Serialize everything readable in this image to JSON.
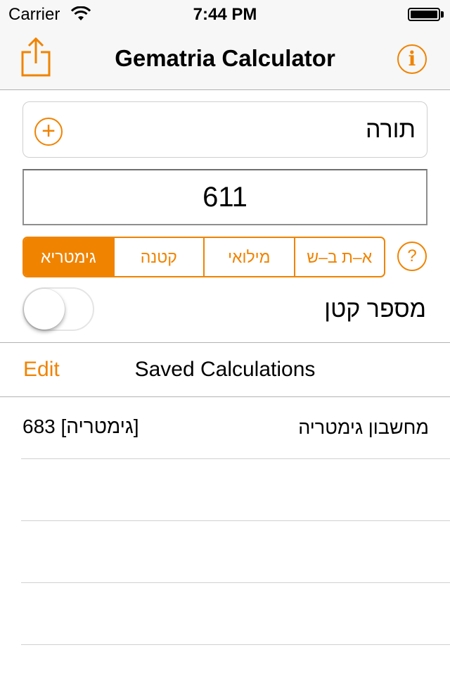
{
  "status_bar": {
    "carrier": "Carrier",
    "time": "7:44 PM"
  },
  "nav": {
    "title": "Gematria Calculator",
    "share_icon": "share-icon",
    "info_icon": "info-icon",
    "info_glyph": "i"
  },
  "word_field": {
    "value": "תורה",
    "add_icon": "add-icon",
    "add_glyph": "+"
  },
  "result": {
    "value": "611"
  },
  "methods": {
    "options": [
      "גימטריא",
      "קטנה",
      "מילואי",
      "א–ת ב–ש"
    ],
    "selected": "גימטריא",
    "help_glyph": "?"
  },
  "small_number": {
    "label": "מספר קטן",
    "enabled": false
  },
  "saved": {
    "edit_label": "Edit",
    "title": "Saved Calculations",
    "items": [
      {
        "value": "683 [גימטריה]",
        "label": "מחשבון גימטריה"
      }
    ]
  },
  "colors": {
    "accent": "#f08300",
    "bar_background": "#f7f7f7",
    "separator": "#b2b2b2"
  }
}
